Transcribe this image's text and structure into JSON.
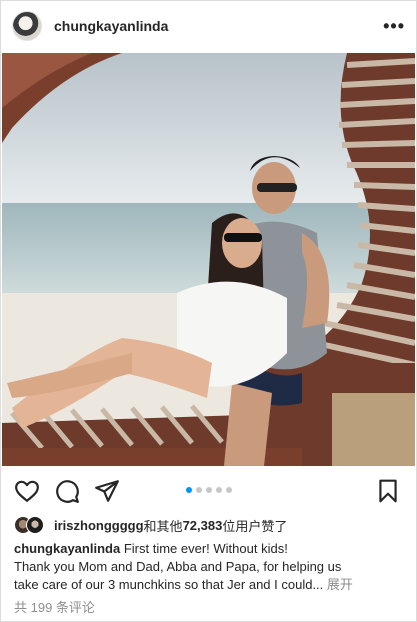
{
  "post": {
    "username": "chungkayanlinda",
    "more_label": "•••"
  },
  "carousel": {
    "count": 5,
    "active": 1
  },
  "likes": {
    "first_liker": "iriszhonggggg",
    "text_and_others": "和其他",
    "count": "72,383",
    "text_suffix": "位用户赞了"
  },
  "caption": {
    "username": "chungkayanlinda",
    "line1": "First time ever!  Without kids!",
    "line2": "Thank you Mom and Dad, Abba and Papa, for helping us",
    "line3": "take care of our 3 munchkins so that Jer and I could...",
    "more_label": "展开"
  },
  "comments": {
    "label": "共 199 条评论"
  },
  "icons": [
    "heart-icon",
    "comment-icon",
    "share-icon",
    "bookmark-icon",
    "more-icon"
  ],
  "colors": {
    "accent": "#0095f6",
    "text": "#262626",
    "muted": "#8e8e8e"
  }
}
